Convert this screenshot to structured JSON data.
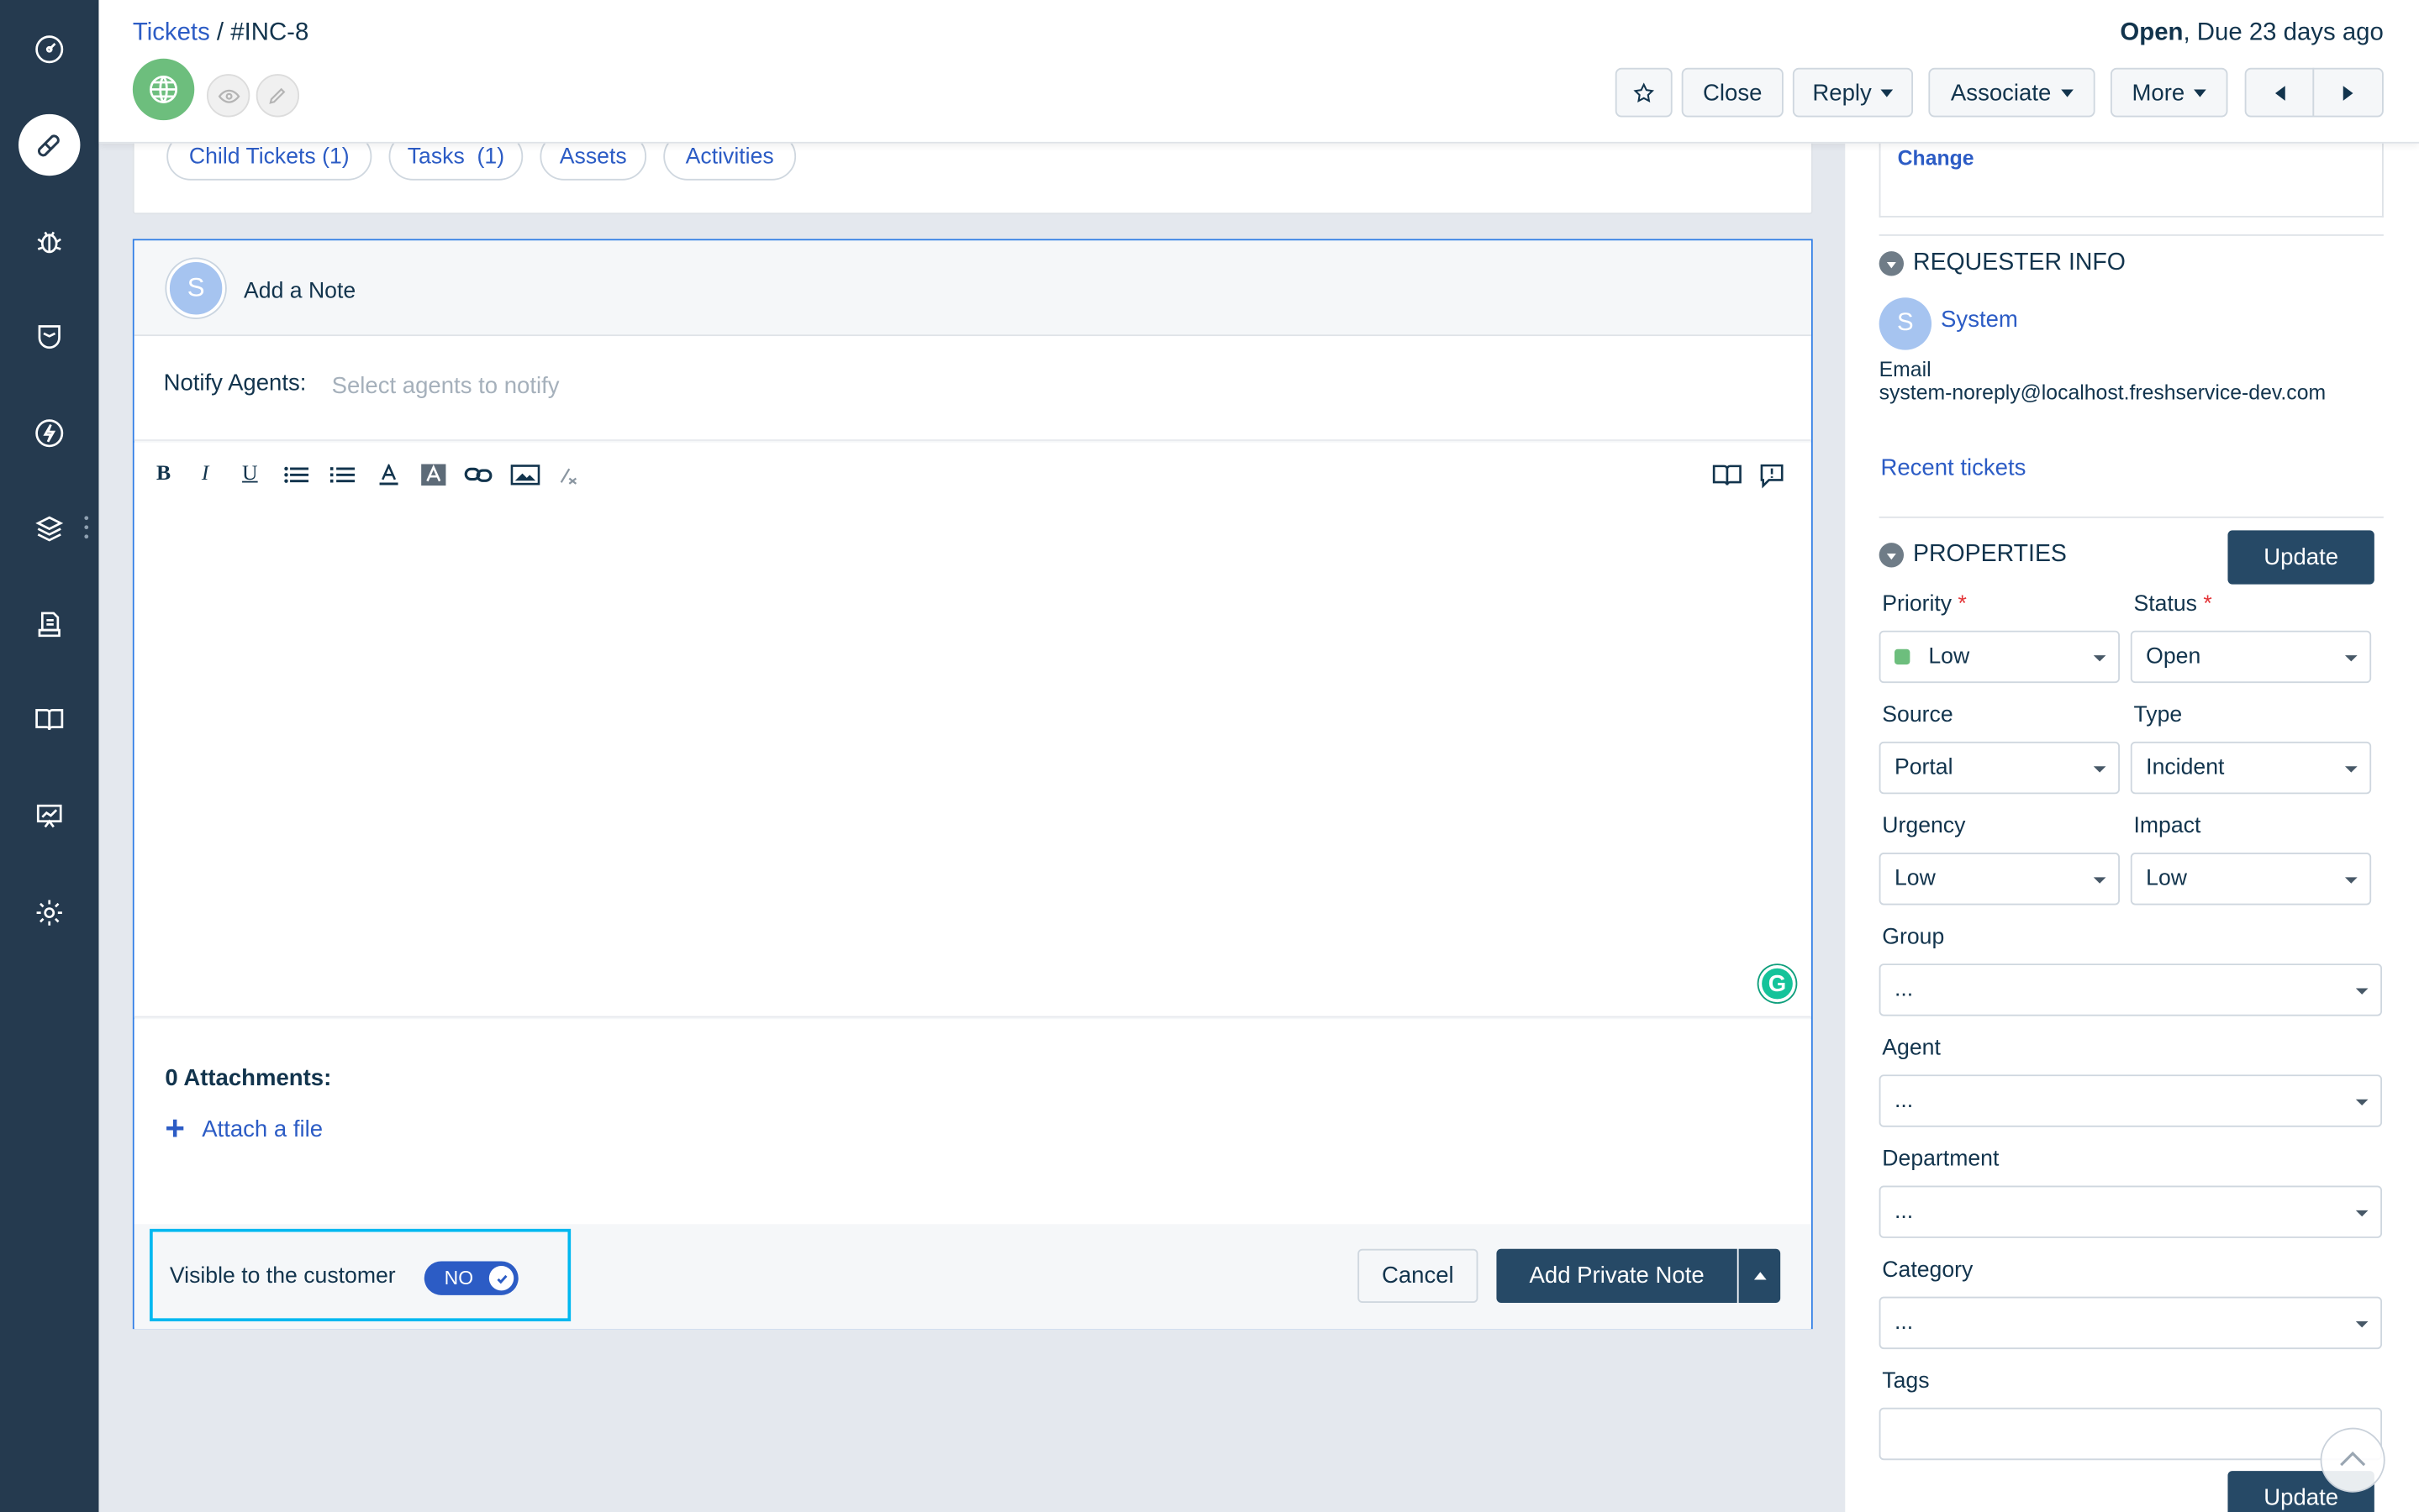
{
  "header": {
    "breadcrumb_link": "Tickets",
    "breadcrumb_sep": " / ",
    "ticket_id": "#INC-8",
    "status_bold": "Open",
    "status_rest": ", Due 23 days ago",
    "buttons": {
      "close": "Close",
      "reply": "Reply",
      "associate": "Associate",
      "more": "More"
    }
  },
  "tabs": [
    "Child Tickets (1)",
    "Tasks  (1)",
    "Assets",
    "Activities"
  ],
  "note": {
    "avatar_initial": "S",
    "title": "Add a Note",
    "notify_label": "Notify Agents:",
    "notify_placeholder": "Select agents to notify",
    "toolbar": [
      "bold-icon",
      "italic-icon",
      "underline-icon",
      "bullet-list-icon",
      "numbered-list-icon",
      "font-color-icon",
      "background-color-icon",
      "link-icon",
      "image-icon",
      "clear-format-icon",
      "canned-response-icon",
      "solution-article-icon"
    ],
    "attachments_title": "0 Attachments:",
    "attach_link": "Attach a file",
    "visible_label": "Visible to the customer",
    "visible_toggle": "NO",
    "cancel": "Cancel",
    "submit": "Add Private Note"
  },
  "right": {
    "change_link": "Change",
    "requester_title": "REQUESTER INFO",
    "requester_initial": "S",
    "requester_name": "System",
    "email_label": "Email",
    "email_value": "system-noreply@localhost.freshservice-dev.com",
    "recent_link": "Recent tickets",
    "properties_title": "PROPERTIES",
    "update_label": "Update",
    "fields": {
      "priority_label": "Priority",
      "priority_value": "Low",
      "status_label": "Status",
      "status_value": "Open",
      "source_label": "Source",
      "source_value": "Portal",
      "type_label": "Type",
      "type_value": "Incident",
      "urgency_label": "Urgency",
      "urgency_value": "Low",
      "impact_label": "Impact",
      "impact_value": "Low",
      "group_label": "Group",
      "group_value": "...",
      "agent_label": "Agent",
      "agent_value": "...",
      "department_label": "Department",
      "department_value": "...",
      "category_label": "Category",
      "category_value": "...",
      "tags_label": "Tags"
    }
  },
  "colors": {
    "sidebar": "#253a4f",
    "accent": "#2c5cc5",
    "primary_button": "#264966",
    "highlight_box": "#00b8f0",
    "priority_low": "#6dbe7d"
  }
}
